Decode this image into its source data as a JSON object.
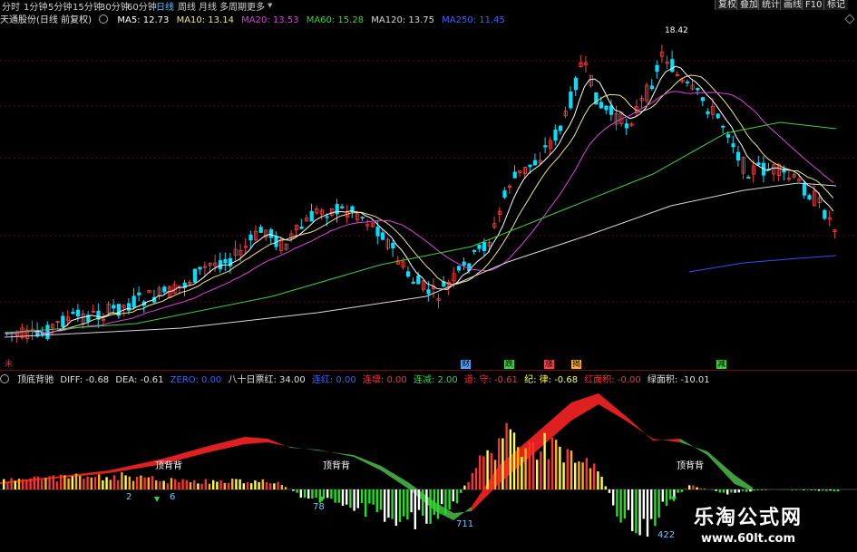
{
  "timeframes": [
    "分时",
    "1分钟",
    "5分钟",
    "15分钟",
    "30分钟",
    "60分钟",
    "日线",
    "周线",
    "月线",
    "多周期",
    "更多"
  ],
  "active_timeframe": "日线",
  "right_buttons": [
    "复权",
    "叠加",
    "统计",
    "画线",
    "F10",
    "标记"
  ],
  "stock": {
    "title": "天通股份(日线 前复权)"
  },
  "ma": [
    {
      "label": "MA5: 12.73",
      "color": "#ffffff"
    },
    {
      "label": "MA10: 13.14",
      "color": "#f0e68c"
    },
    {
      "label": "MA20: 13.53",
      "color": "#e040e0"
    },
    {
      "label": "MA60: 15.28",
      "color": "#3cd23c"
    },
    {
      "label": "MA120: 13.75",
      "color": "#d8d8d8"
    },
    {
      "label": "MA250: 11.45",
      "color": "#4060ff"
    }
  ],
  "high_label": "18.42",
  "markers": [
    {
      "text": "未",
      "color": "#d33",
      "bg": "transparent"
    },
    {
      "text": "财",
      "color": "#000",
      "bg": "#4aa3ff"
    },
    {
      "text": "跌",
      "color": "#000",
      "bg": "#3cd23c"
    },
    {
      "text": "涨",
      "color": "#000",
      "bg": "#ff4040"
    },
    {
      "text": "揭",
      "color": "#000",
      "bg": "#ffb020"
    },
    {
      "text": "减",
      "color": "#000",
      "bg": "#3cd23c"
    }
  ],
  "indicator": {
    "name": "顶底背驰",
    "items": [
      {
        "label": "DIFF: -0.68",
        "color": "#e0e0e0"
      },
      {
        "label": "DEA: -0.61",
        "color": "#e0e0e0"
      },
      {
        "label": "ZERO: 0.00",
        "color": "#4060ff"
      },
      {
        "label": "八十日票红: 34.00",
        "color": "#e0e0e0"
      },
      {
        "label": "连红: 0.00",
        "color": "#4060ff"
      },
      {
        "label": "连增: 0.00",
        "color": "#ff3030"
      },
      {
        "label": "连减: 2.00",
        "color": "#3cd23c"
      },
      {
        "label": "道: 守: -0.61",
        "color": "#ff3030"
      },
      {
        "label": "纪: 律: -0.68",
        "color": "#ffff40"
      },
      {
        "label": "红面积: -0.00",
        "color": "#ff3030"
      },
      {
        "label": "绿面积: -10.01",
        "color": "#e0e0e0"
      }
    ]
  },
  "annotations": [
    "顶背背",
    "顶背背",
    "顶背背"
  ],
  "counts": [
    "2",
    "6",
    "78",
    "711",
    "422"
  ],
  "logo": {
    "name": "乐淘公式网",
    "url": "www.60lt.com"
  },
  "colors": {
    "up": "#ff3c3c",
    "down": "#00e0ff",
    "ma5": "#ffffff",
    "ma10": "#f0e68c",
    "ma20": "#e040e0",
    "ma60": "#3cd23c",
    "ma120": "#d8d8d8",
    "ma250": "#3050ff"
  }
}
